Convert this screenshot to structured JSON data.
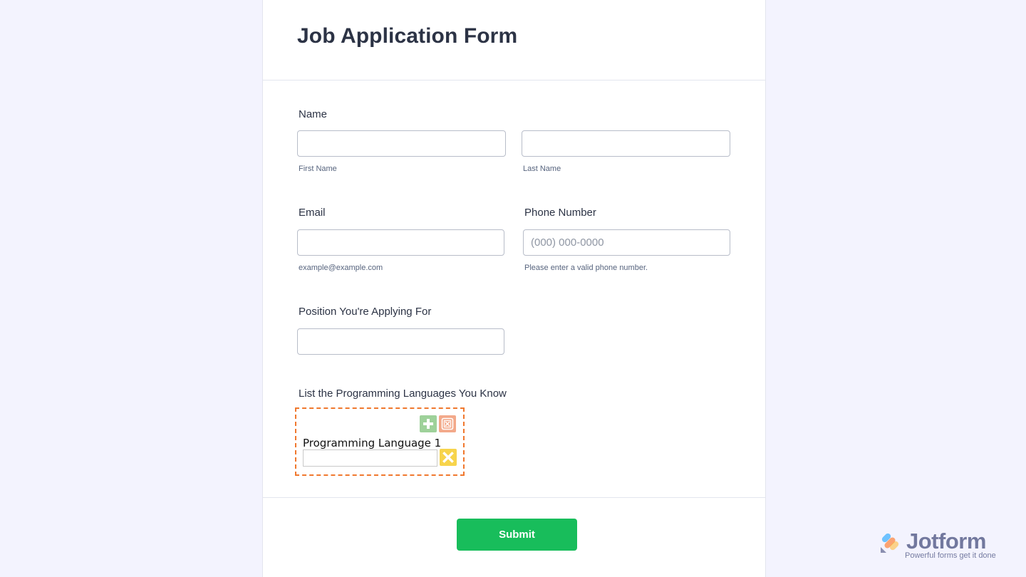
{
  "form": {
    "title": "Job Application Form",
    "name": {
      "label": "Name",
      "first_sublabel": "First Name",
      "last_sublabel": "Last Name",
      "first_value": "",
      "last_value": ""
    },
    "email": {
      "label": "Email",
      "sublabel": "example@example.com",
      "value": ""
    },
    "phone": {
      "label": "Phone Number",
      "placeholder": "(000) 000-0000",
      "sublabel": "Please enter a valid phone number.",
      "value": ""
    },
    "position": {
      "label": "Position You're Applying For",
      "value": ""
    },
    "languages": {
      "label": "List the Programming Languages You Know",
      "item_label": "Programming Language 1",
      "item_value": "",
      "add_icon": "plus-icon",
      "clear_icon": "clear-all-icon",
      "remove_icon": "close-icon"
    },
    "submit_label": "Submit"
  },
  "branding": {
    "name": "Jotform",
    "tagline": "Powerful forms get it done"
  },
  "colors": {
    "background": "#f3f3fe",
    "submit": "#18bd5b",
    "widget_border": "#f0782e",
    "add_button": "#9ed19a",
    "clear_button": "#f3a98a",
    "remove_button": "#f7d44c"
  }
}
